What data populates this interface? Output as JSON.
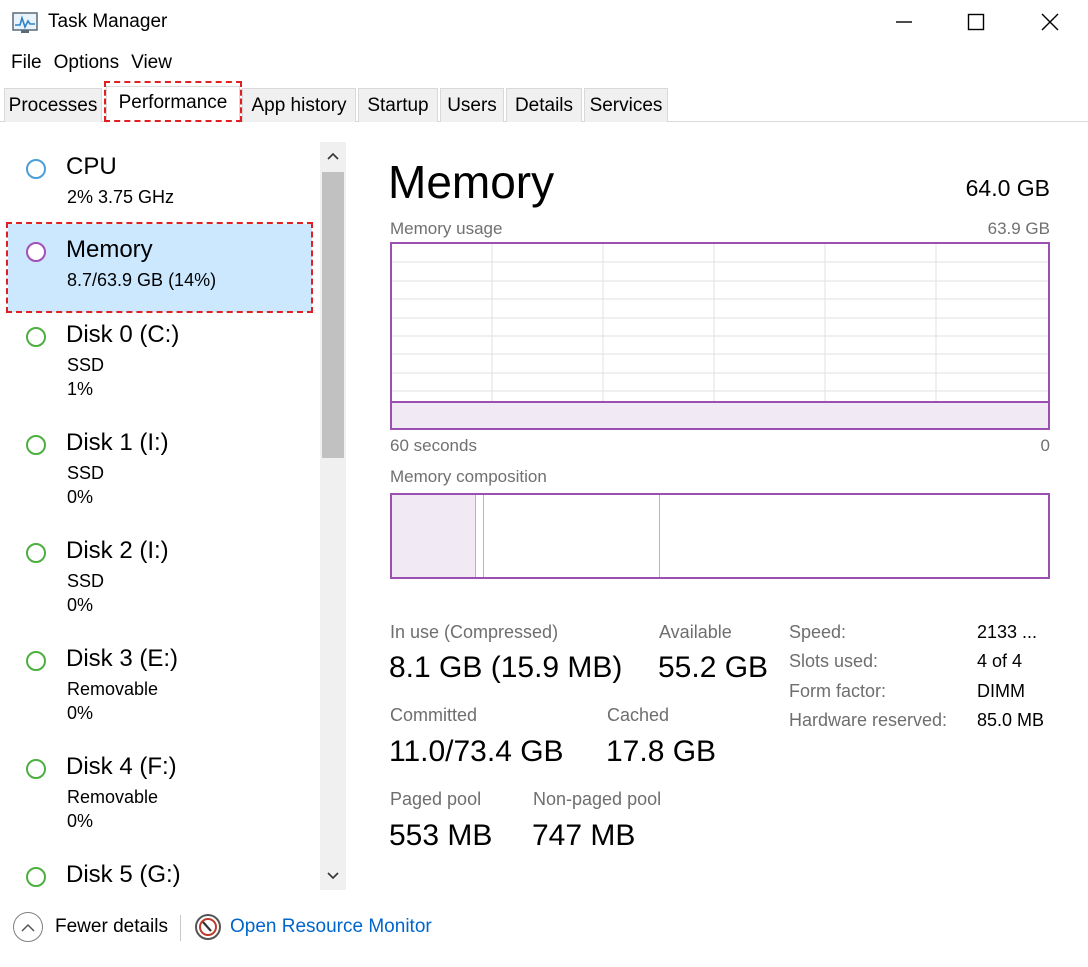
{
  "window": {
    "title": "Task Manager",
    "minimize_glyph": "—",
    "maximize_glyph": "☐",
    "close_glyph": "✕"
  },
  "menu": [
    "File",
    "Options",
    "View"
  ],
  "tabs": [
    {
      "label": "Processes",
      "active": false
    },
    {
      "label": "Performance",
      "active": true
    },
    {
      "label": "App history",
      "active": false
    },
    {
      "label": "Startup",
      "active": false
    },
    {
      "label": "Users",
      "active": false
    },
    {
      "label": "Details",
      "active": false
    },
    {
      "label": "Services",
      "active": false
    }
  ],
  "resources": [
    {
      "name": "CPU",
      "lines": [
        "2% 3.75 GHz"
      ],
      "color": "#4a9fd8",
      "selected": false
    },
    {
      "name": "Memory",
      "lines": [
        "8.7/63.9 GB (14%)"
      ],
      "color": "#a44fb8",
      "selected": true
    },
    {
      "name": "Disk 0 (C:)",
      "lines": [
        "SSD",
        "1%"
      ],
      "color": "#4caf3f",
      "selected": false
    },
    {
      "name": "Disk 1 (I:)",
      "lines": [
        "SSD",
        "0%"
      ],
      "color": "#4caf3f",
      "selected": false
    },
    {
      "name": "Disk 2 (I:)",
      "lines": [
        "SSD",
        "0%"
      ],
      "color": "#4caf3f",
      "selected": false
    },
    {
      "name": "Disk 3 (E:)",
      "lines": [
        "Removable",
        "0%"
      ],
      "color": "#4caf3f",
      "selected": false
    },
    {
      "name": "Disk 4 (F:)",
      "lines": [
        "Removable",
        "0%"
      ],
      "color": "#4caf3f",
      "selected": false
    },
    {
      "name": "Disk 5 (G:)",
      "lines": [],
      "color": "#4caf3f",
      "selected": false
    }
  ],
  "detail": {
    "title": "Memory",
    "total": "64.0 GB",
    "usage_label": "Memory usage",
    "usage_max": "63.9 GB",
    "time_left": "60 seconds",
    "time_right": "0",
    "composition_label": "Memory composition",
    "usage_fraction": 0.14,
    "stats": {
      "in_use_label": "In use (Compressed)",
      "in_use_value": "8.1 GB (15.9 MB)",
      "available_label": "Available",
      "available_value": "55.2 GB",
      "committed_label": "Committed",
      "committed_value": "11.0/73.4 GB",
      "cached_label": "Cached",
      "cached_value": "17.8 GB",
      "paged_label": "Paged pool",
      "paged_value": "553 MB",
      "nonpaged_label": "Non-paged pool",
      "nonpaged_value": "747 MB"
    },
    "specs": [
      {
        "label": "Speed:",
        "value": "2133 ..."
      },
      {
        "label": "Slots used:",
        "value": "4 of 4"
      },
      {
        "label": "Form factor:",
        "value": "DIMM"
      },
      {
        "label": "Hardware reserved:",
        "value": "85.0 MB"
      }
    ]
  },
  "footer": {
    "fewer_details": "Fewer details",
    "resource_monitor": "Open Resource Monitor"
  },
  "colors": {
    "memory": "#9b4fb0",
    "highlight": "#e02020",
    "selection": "#cce8ff",
    "link": "#0066cc"
  }
}
